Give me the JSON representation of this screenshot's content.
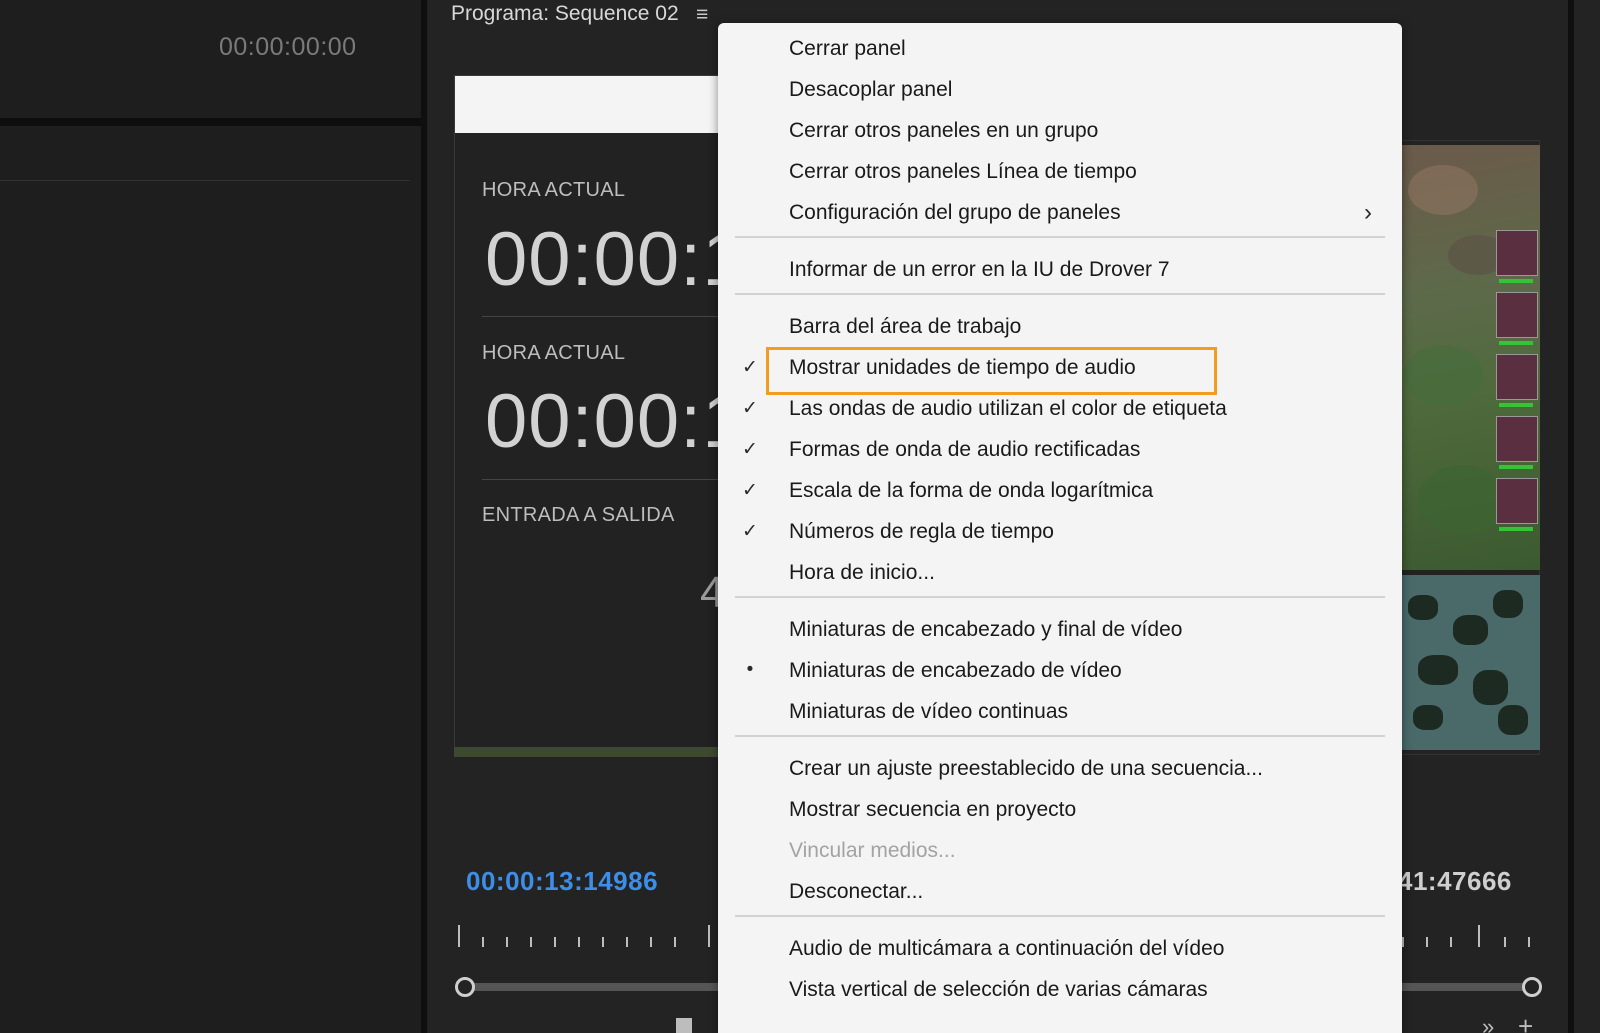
{
  "left_panel": {
    "timecode": "00:00:00:00"
  },
  "program_monitor": {
    "title": "Programa: Sequence 02",
    "menu_icon": "≡",
    "dialog": {
      "label_1": "HORA ACTUAL",
      "time_1": "00:00:1",
      "label_2": "HORA ACTUAL",
      "time_2": "00:00:1",
      "label_3": "ENTRADA A SALIDA",
      "partial_value": "4"
    },
    "current_timecode": "00:00:13:14986",
    "duration_timecode": "41:47666",
    "accent_color": "#3d8ee8"
  },
  "context_menu": {
    "items": [
      {
        "label": "Cerrar panel",
        "mark": "",
        "submenu": false,
        "disabled": false
      },
      {
        "label": "Desacoplar panel",
        "mark": "",
        "submenu": false,
        "disabled": false
      },
      {
        "label": "Cerrar otros paneles en un grupo",
        "mark": "",
        "submenu": false,
        "disabled": false
      },
      {
        "label": "Cerrar otros paneles Línea de tiempo",
        "mark": "",
        "submenu": false,
        "disabled": false
      },
      {
        "label": "Configuración del grupo de paneles",
        "mark": "",
        "submenu": true,
        "disabled": false
      },
      {
        "label": "Informar de un error en la IU de Drover 7",
        "mark": "",
        "submenu": false,
        "disabled": false
      },
      {
        "label": "Barra del área de trabajo",
        "mark": "",
        "submenu": false,
        "disabled": false
      },
      {
        "label": "Mostrar unidades de tiempo de audio",
        "mark": "✓",
        "submenu": false,
        "disabled": false
      },
      {
        "label": "Las ondas de audio utilizan el color de etiqueta",
        "mark": "✓",
        "submenu": false,
        "disabled": false
      },
      {
        "label": "Formas de onda de audio rectificadas",
        "mark": "✓",
        "submenu": false,
        "disabled": false
      },
      {
        "label": "Escala de la forma de onda logarítmica",
        "mark": "✓",
        "submenu": false,
        "disabled": false
      },
      {
        "label": "Números de regla de tiempo",
        "mark": "✓",
        "submenu": false,
        "disabled": false
      },
      {
        "label": "Hora de inicio...",
        "mark": "",
        "submenu": false,
        "disabled": false
      },
      {
        "label": "Miniaturas de encabezado y final de vídeo",
        "mark": "",
        "submenu": false,
        "disabled": false
      },
      {
        "label": "Miniaturas de encabezado de vídeo",
        "mark": "•",
        "submenu": false,
        "disabled": false
      },
      {
        "label": "Miniaturas de vídeo continuas",
        "mark": "",
        "submenu": false,
        "disabled": false
      },
      {
        "label": "Crear un ajuste preestablecido de una secuencia...",
        "mark": "",
        "submenu": false,
        "disabled": false
      },
      {
        "label": "Mostrar secuencia en proyecto",
        "mark": "",
        "submenu": false,
        "disabled": false
      },
      {
        "label": "Vincular medios...",
        "mark": "",
        "submenu": false,
        "disabled": true
      },
      {
        "label": "Desconectar...",
        "mark": "",
        "submenu": false,
        "disabled": false
      },
      {
        "label": "Audio de multicámara a continuación del vídeo",
        "mark": "",
        "submenu": false,
        "disabled": false
      },
      {
        "label": "Vista vertical de selección de varias cámaras",
        "mark": "",
        "submenu": false,
        "disabled": false
      }
    ],
    "submenu_arrow": "›",
    "highlight_color": "#f39c1f"
  }
}
